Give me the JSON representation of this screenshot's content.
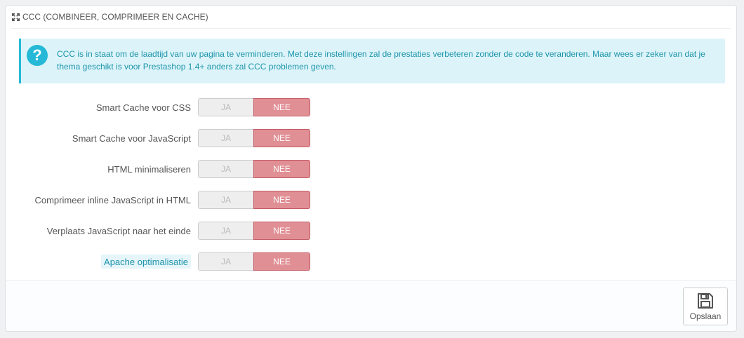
{
  "panel": {
    "title": "CCC (COMBINEER, COMPRIMEER EN CACHE)",
    "icon": "expand-icon"
  },
  "alert": {
    "icon": "question-icon",
    "text": "CCC is in staat om de laadtijd van uw pagina te verminderen. Met deze instellingen zal de prestaties verbeteren zonder de code te veranderen. Maar wees er zeker van dat je thema geschikt is voor Prestashop 1.4+ anders zal CCC problemen geven."
  },
  "settings": [
    {
      "label": "Smart Cache voor CSS",
      "yes": "JA",
      "no": "NEE",
      "value": "NEE"
    },
    {
      "label": "Smart Cache voor JavaScript",
      "yes": "JA",
      "no": "NEE",
      "value": "NEE"
    },
    {
      "label": "HTML minimaliseren",
      "yes": "JA",
      "no": "NEE",
      "value": "NEE"
    },
    {
      "label": "Comprimeer inline JavaScript in HTML",
      "yes": "JA",
      "no": "NEE",
      "value": "NEE"
    },
    {
      "label": "Verplaats JavaScript naar het einde",
      "yes": "JA",
      "no": "NEE",
      "value": "NEE"
    },
    {
      "label": "Apache optimalisatie",
      "yes": "JA",
      "no": "NEE",
      "value": "NEE"
    }
  ],
  "footer": {
    "save_label": "Opslaan",
    "save_icon": "floppy-disk-icon"
  },
  "colors": {
    "info_bg": "#dcf4f9",
    "info_accent": "#25b9d7",
    "switch_no_active": "#e08f95"
  }
}
